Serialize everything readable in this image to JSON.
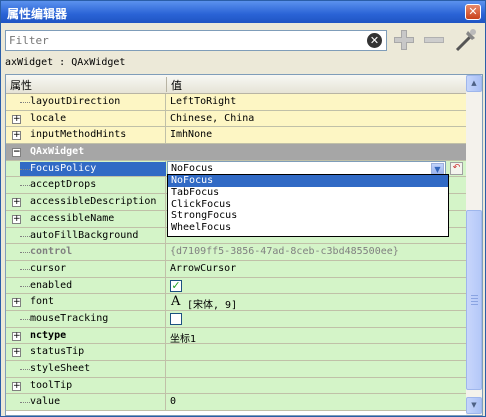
{
  "window": {
    "title": "属性编辑器",
    "close_glyph": "✕"
  },
  "toolbar": {
    "filter_placeholder": "Filter",
    "icons": [
      "clear-filter-icon",
      "add-property-icon",
      "remove-property-icon",
      "configure-icon"
    ],
    "colors": {
      "plus": "#a0a0a0",
      "accent": "#316ac5"
    }
  },
  "object_label": "axWidget : QAxWidget",
  "header": {
    "property": "属性",
    "value": "值"
  },
  "rows": [
    {
      "name": "layoutDirection",
      "value": "LeftToRight"
    },
    {
      "name": "locale",
      "value": "Chinese, China"
    },
    {
      "name": "inputMethodHints",
      "value": "ImhNone"
    },
    {
      "name": "QAxWidget"
    },
    {
      "name": "FocusPolicy",
      "value": "NoFocus"
    },
    {
      "name": "acceptDrops"
    },
    {
      "name": "accessibleDescription"
    },
    {
      "name": "accessibleName"
    },
    {
      "name": "autoFillBackground"
    },
    {
      "name": "control",
      "value": "{d7109ff5-3856-47ad-8ceb-c3bd485500ee}"
    },
    {
      "name": "cursor",
      "value": "ArrowCursor"
    },
    {
      "name": "enabled",
      "checked": true
    },
    {
      "name": "font",
      "value": "[宋体, 9]",
      "glyph": "A"
    },
    {
      "name": "mouseTracking",
      "checked": false
    },
    {
      "name": "nctype",
      "value": "坐标1"
    },
    {
      "name": "statusTip",
      "value": ""
    },
    {
      "name": "styleSheet",
      "value": ""
    },
    {
      "name": "toolTip",
      "value": ""
    },
    {
      "name": "value",
      "value": "0"
    }
  ],
  "dropdown": {
    "options": [
      "NoFocus",
      "TabFocus",
      "ClickFocus",
      "StrongFocus",
      "WheelFocus"
    ],
    "selected": "NoFocus"
  },
  "glyphs": {
    "expand": "+",
    "collapse": "−",
    "check": "✓",
    "reset": "↶",
    "arrow_down": "▼",
    "arrow_up": "▲",
    "clear": "✕"
  }
}
